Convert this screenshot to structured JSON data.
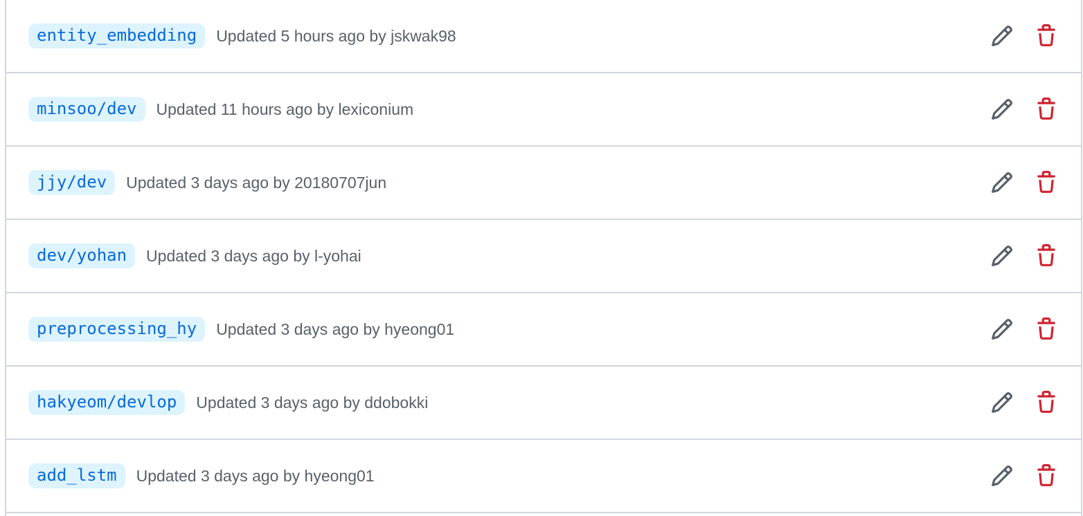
{
  "branches": [
    {
      "name": "entity_embedding",
      "meta": "Updated 5 hours ago by jskwak98"
    },
    {
      "name": "minsoo/dev",
      "meta": "Updated 11 hours ago by lexiconium"
    },
    {
      "name": "jjy/dev",
      "meta": "Updated 3 days ago by 20180707jun"
    },
    {
      "name": "dev/yohan",
      "meta": "Updated 3 days ago by l-yohai"
    },
    {
      "name": "preprocessing_hy",
      "meta": "Updated 3 days ago by hyeong01"
    },
    {
      "name": "hakyeom/devlop",
      "meta": "Updated 3 days ago by ddobokki"
    },
    {
      "name": "add_lstm",
      "meta": "Updated 3 days ago by hyeong01"
    }
  ],
  "icons": {
    "edit": "pencil-icon",
    "delete": "trash-icon"
  },
  "colors": {
    "branch_text": "#0969da",
    "branch_bg": "#ddf4ff",
    "meta_text": "#57606a",
    "edit_icon": "#57606a",
    "delete_icon": "#cf222e",
    "border": "#d0d7de"
  }
}
